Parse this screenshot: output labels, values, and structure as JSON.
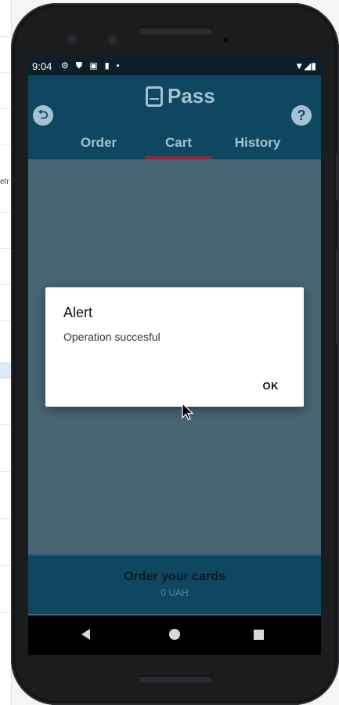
{
  "background": {
    "fragment_text": "etr"
  },
  "status_bar": {
    "time": "9:04",
    "icons": "⚙ ⛊ ▣ ▮ •",
    "right_icons": "▼◢▮"
  },
  "app": {
    "title": "Pass",
    "tabs": [
      {
        "label": "Order"
      },
      {
        "label": "Cart"
      },
      {
        "label": "History"
      }
    ],
    "help_label": "?",
    "back_label": "⮌"
  },
  "dialog": {
    "title": "Alert",
    "message": "Operation succesful",
    "ok_label": "OK"
  },
  "bottom_bar": {
    "title": "Order your cards",
    "subtitle": "0 UAH"
  },
  "colors": {
    "app_bar": "#0f4763",
    "accent_inactive": "#a4c2d2",
    "tab_indicator": "#8a2a3c",
    "scrim": "#466472"
  }
}
